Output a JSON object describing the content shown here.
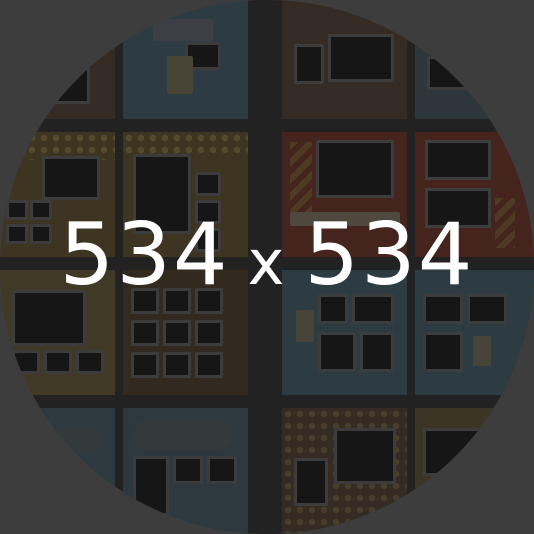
{
  "label": {
    "width": "534",
    "separator": "x",
    "height": "534"
  },
  "colors": {
    "background": "#3d3d3d",
    "label_text": "#ffffff"
  },
  "tiles_visible": 16
}
